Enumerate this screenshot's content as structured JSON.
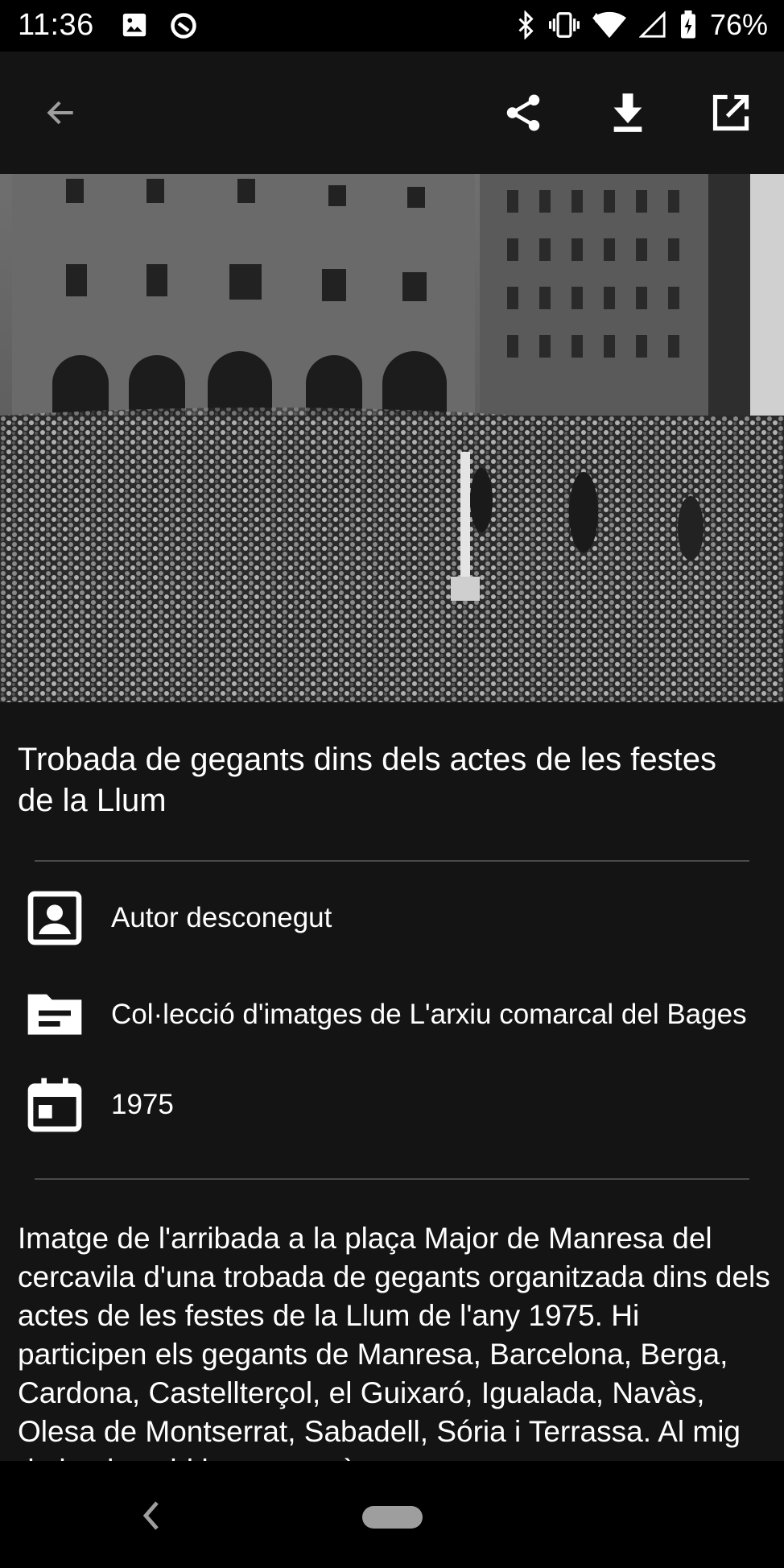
{
  "status_bar": {
    "time": "11:36",
    "battery": "76%"
  },
  "toolbar": {
    "back_icon": "arrow-back-icon",
    "share_icon": "share-icon",
    "download_icon": "download-icon",
    "open_external_icon": "open-in-new-icon"
  },
  "photo": {
    "description_icon": "historical-photo"
  },
  "item": {
    "title": "Trobada de gegants dins dels actes de les festes de la Llum",
    "author": "Autor desconegut",
    "collection": "Col·lecció d'imatges de L'arxiu comarcal del Bages",
    "year": "1975",
    "description": "Imatge de l'arribada a la plaça Major de Manresa del cercavila d'una trobada de gegants organitzada dins dels actes de les festes de la Llum de l'any 1975. Hi participen els gegants de Manresa, Barcelona, Berga, Cardona, Castellterçol, el Guixaró, Igualada, Navàs, Olesa de Montserrat, Sabadell, Sória i Terrassa. Al mig de la plaça hi ha una estàtua"
  },
  "colors": {
    "background": "#141414",
    "status_bar": "#000000",
    "text": "#ffffff",
    "divider": "#4a4a4a"
  }
}
